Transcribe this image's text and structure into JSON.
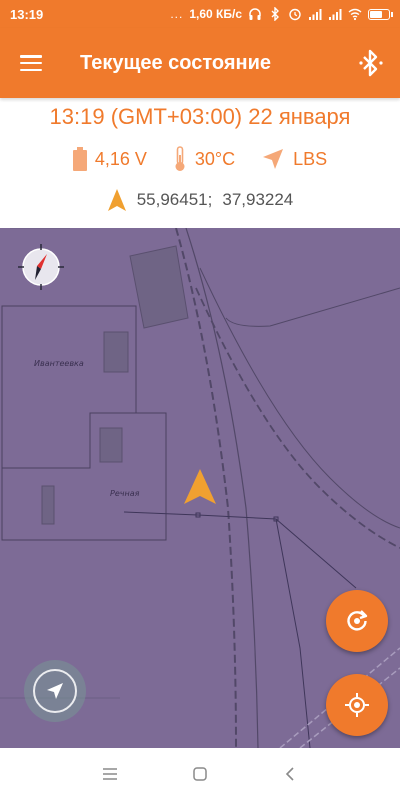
{
  "status_bar": {
    "time": "13:19",
    "dots": "...",
    "network_speed": "1,60 КБ/с",
    "icons": [
      "headphones-icon",
      "bluetooth-icon",
      "alarm-icon",
      "signal-icon",
      "signal-icon",
      "wifi-icon",
      "battery-icon"
    ]
  },
  "toolbar": {
    "title": "Текущее состояние",
    "menu_icon": "hamburger-menu-icon",
    "action_icon": "bluetooth-icon"
  },
  "info": {
    "datetime": "13:19 (GMT+03:00) 22 января",
    "voltage": "4,16 V",
    "temperature": "30°C",
    "location_source": "LBS",
    "latitude": "55,96451;",
    "longitude": "37,93224"
  },
  "map": {
    "labels": [
      "Ивантеевка",
      "Речная"
    ],
    "background_color": "#7d6b96"
  },
  "colors": {
    "accent": "#f07a2c",
    "text_secondary": "#555555"
  },
  "controls": {
    "refresh_icon": "refresh-icon",
    "locate_icon": "crosshair-icon",
    "navigation_icon": "navigation-arrow-icon",
    "compass_icon": "compass-icon"
  },
  "navigation_bar": {
    "icons": [
      "recents-icon",
      "home-icon",
      "back-icon"
    ]
  }
}
